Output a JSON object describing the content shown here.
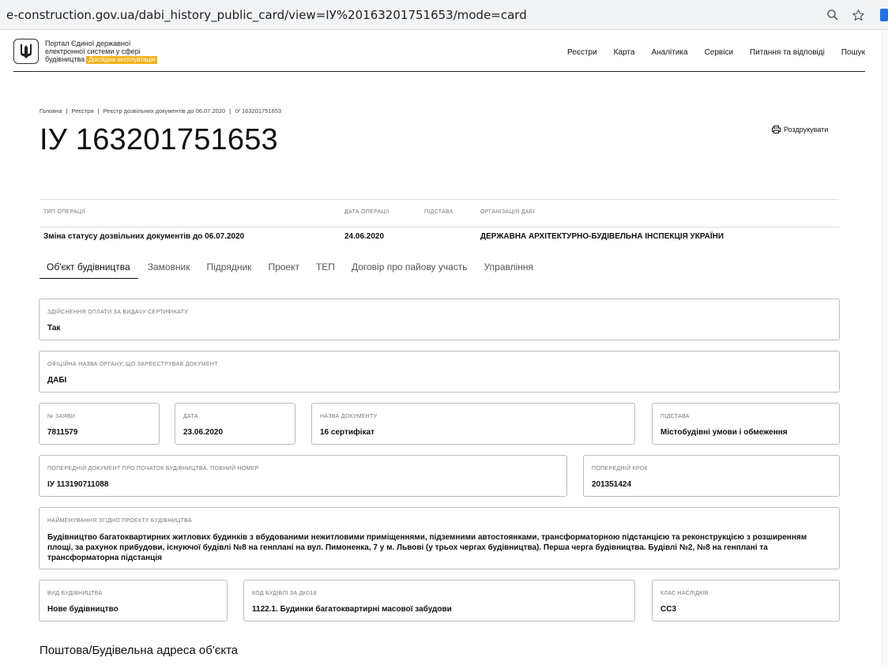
{
  "browser": {
    "url": "e-construction.gov.ua/dabi_history_public_card/view=ІУ%20163201751653/mode=card"
  },
  "header": {
    "brand_line1": "Портал Єдиної державної",
    "brand_line2": "електронної системи у сфері",
    "brand_line3": "будівництва",
    "badge": "Дослідна експлуатація",
    "nav": [
      "Реєстри",
      "Карта",
      "Аналітика",
      "Сервіси",
      "Питання та відповіді",
      "Пошук"
    ]
  },
  "breadcrumb": [
    "Головна",
    "Реєстри",
    "Реєстр дозвільних документів до 06.07.2020",
    "ІУ 163201751653"
  ],
  "page_title": "ІУ 163201751653",
  "print_label": "Роздрукувати",
  "operation": {
    "headers": [
      "ТИП ОПЕРАЦІЇ",
      "ДАТА ОПЕРАЦІЇ",
      "ПІДСТАВА",
      "ОРГАНІЗАЦІЯ ДАБІ"
    ],
    "row": [
      "Зміна статусу дозвільних документів до 06.07.2020",
      "24.06.2020",
      "",
      "ДЕРЖАВНА АРХІТЕКТУРНО-БУДІВЕЛЬНА ІНСПЕКЦІЯ УКРАЇНИ"
    ]
  },
  "tabs": [
    "Об'єкт будівництва",
    "Замовник",
    "Підрядник",
    "Проект",
    "ТЕП",
    "Договір про пайову участь",
    "Управління"
  ],
  "fields": {
    "payment": {
      "label": "ЗДІЙСНЕННЯ ОПЛАТИ ЗА ВИДАЧУ СЕРТИФІКАТУ",
      "value": "Так"
    },
    "official_body": {
      "label": "ОФІЦІЙНА НАЗВА ОРГАНУ, ЩО ЗАРЕЄСТРУВАВ ДОКУМЕНТ",
      "value": "ДАБІ"
    },
    "app_no": {
      "label": "№ ЗАЯВИ",
      "value": "7811579"
    },
    "date": {
      "label": "ДАТА",
      "value": "23.06.2020"
    },
    "doc_name": {
      "label": "НАЗВА ДОКУМЕНТУ",
      "value": "16 сертифікат"
    },
    "basis": {
      "label": "ПІДСТАВА",
      "value": "Містобудівні умови і обмеження"
    },
    "prev_doc": {
      "label": "ПОПЕРЕДНІЙ ДОКУМЕНТ ПРО ПОЧАТОК БУДІВНИЦТВА, ПОВНИЙ НОМЕР",
      "value": "ІУ 113190711088"
    },
    "prev_step": {
      "label": "ПОПЕРЕДНІЙ КРОК",
      "value": "201351424"
    },
    "project_name": {
      "label": "НАЙМЕНУВАННЯ ЗГІДНО ПРОЕКТУ БУДІВНИЦТВА",
      "value": "Будівництво багатоквартирних житлових будинків з вбудованими нежитловими приміщеннями, підземними автостоянками, трансформаторною підстанцією та реконструкцією з розширенням площі, за рахунок прибудови, існуючої будівлі №8 на генплані на вул. Пимоненка, 7 у м. Львові (у трьох чергах будівництва). Перша черга будівництва. Будівлі №2, №8 на генплані та трансформаторна підстанція"
    },
    "build_type": {
      "label": "ВИД БУДІВНИЦТВА",
      "value": "Нове будівництво"
    },
    "building_code": {
      "label": "КОД БУДІВЛІ ЗА ДК018",
      "value": "1122.1. Будинки багатоквартирні масової забудови"
    },
    "class": {
      "label": "КЛАС НАСЛІДКІВ",
      "value": "СС3"
    }
  },
  "section_title": "Поштова/Будівельна адреса об'єкта"
}
